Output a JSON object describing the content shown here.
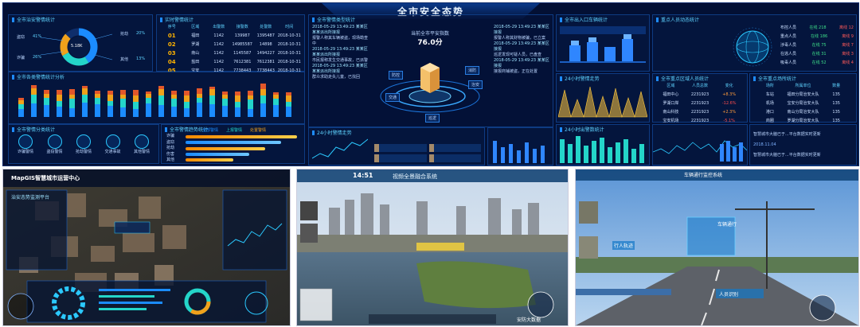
{
  "dashboard": {
    "title": "全市安全态势",
    "panels": {
      "p1": {
        "title": "全市治安警情统计",
        "center_value": "5.18K",
        "legend": [
          "盗窃",
          "诈骗",
          "抢劫",
          "其他"
        ],
        "values": [
          "41%",
          "26%",
          "20%",
          "13%"
        ]
      },
      "p2": {
        "title": "实时警情统计",
        "headers": [
          "序号",
          "区域",
          "出警数",
          "接警数",
          "处警数",
          "时间"
        ],
        "rows": [
          [
            "01",
            "福田",
            "1142",
            "139987",
            "1395487",
            "2018-10-31"
          ],
          [
            "02",
            "罗湖",
            "1142",
            "14985587",
            "14898",
            "2018-10-31"
          ],
          [
            "03",
            "南山",
            "1142",
            "1145587",
            "1494227",
            "2018-10-31"
          ],
          [
            "04",
            "盐田",
            "1142",
            "7612381",
            "7612381",
            "2018-10-31"
          ],
          [
            "05",
            "宝安",
            "1142",
            "7738443",
            "7738443",
            "2018-10-31"
          ]
        ]
      },
      "p3": {
        "title": "全市警情类型统计",
        "gauge_label": "当前全市平安指数",
        "gauge_value": "76.0分",
        "nodes": [
          "防控",
          "治安",
          "交通",
          "消防",
          "巡逻"
        ]
      },
      "p4": {
        "title": "全市出入口车辆统计"
      },
      "p5": {
        "title": "重点人员动态统计",
        "rows": [
          [
            "布控人员",
            "在线 218",
            "离线 12"
          ],
          [
            "重点人员",
            "在线 186",
            "离线 9"
          ],
          [
            "涉毒人员",
            "在线 75",
            "离线 7"
          ],
          [
            "在逃人员",
            "在线 31",
            "离线 3"
          ],
          [
            "吸毒人员",
            "在线 52",
            "离线 4"
          ]
        ]
      },
      "p6": {
        "title": "全市各类警情统计分析"
      },
      "p7": {
        "title": "全市警情分类统计",
        "items": [
          "诈骗警情",
          "盗窃警情",
          "抢劫警情",
          "交通事故",
          "其他警情"
        ]
      },
      "p8": {
        "title": "全市警情趋势统计"
      },
      "p9": {
        "title": "24小时警情走势"
      },
      "p10": {
        "title": "24小时出警数统计"
      },
      "p11": {
        "title": "全市重点区域人员统计",
        "headers": [
          "区域",
          "人员总数",
          "变化"
        ],
        "rows": [
          [
            "福田中心",
            "2231923",
            "+8.3%"
          ],
          [
            "罗湖口岸",
            "2231923",
            "-12.6%"
          ],
          [
            "南山科技",
            "2231923",
            "+2.3%"
          ],
          [
            "宝安机场",
            "2231923",
            "-5.1%"
          ]
        ]
      },
      "p12": {
        "title": "全市重点场所统计",
        "headers": [
          "场所",
          "所属单位",
          "数量"
        ],
        "rows": [
          [
            "车站",
            "福田分局治安大队",
            "135"
          ],
          [
            "机场",
            "宝安分局治安大队",
            "135"
          ],
          [
            "港口",
            "南山分局治安大队",
            "135"
          ],
          [
            "商圈",
            "罗湖分局治安大队",
            "135"
          ]
        ]
      },
      "feed": [
        "2018-05-29 13:49:23 某某区某某派出所接报",
        "报警人称其车辆被盗，现场勘查中",
        "2018-05-29 13:49:23 某某区某某派出所接报",
        "市民报称发生交通事故，已派警",
        "2018-05-29 13:49:23 某某区某某派出所接报",
        "群众求助走失儿童，已找回"
      ],
      "feed2": [
        "2018-05-29 13:49:23 某某区接报",
        "报警人称其财物被骗，已立案",
        "2018-05-29 13:49:23 某某区接报",
        "巡逻发现可疑人员，已盘查",
        "2018-05-29 13:49:23 某某区接报",
        "接报商铺被盗，正在处置"
      ],
      "legend": [
        "全部警情",
        "上报警情",
        "处置警情"
      ],
      "notes": [
        "智慧城市大脑已于...平台数据实时更新",
        "2018.11.04"
      ]
    }
  },
  "screen2": {
    "brand": "MapGIS智慧城市运营中心",
    "subtitle": "治安态势监测平台"
  },
  "screen3": {
    "time": "14:51",
    "title": "视频全景融合系统",
    "footer": "安防大数据"
  },
  "screen4": {
    "title": "车辆通行监控系统",
    "tags": [
      "车辆通行",
      "行人轨迹",
      "人员识别"
    ]
  }
}
